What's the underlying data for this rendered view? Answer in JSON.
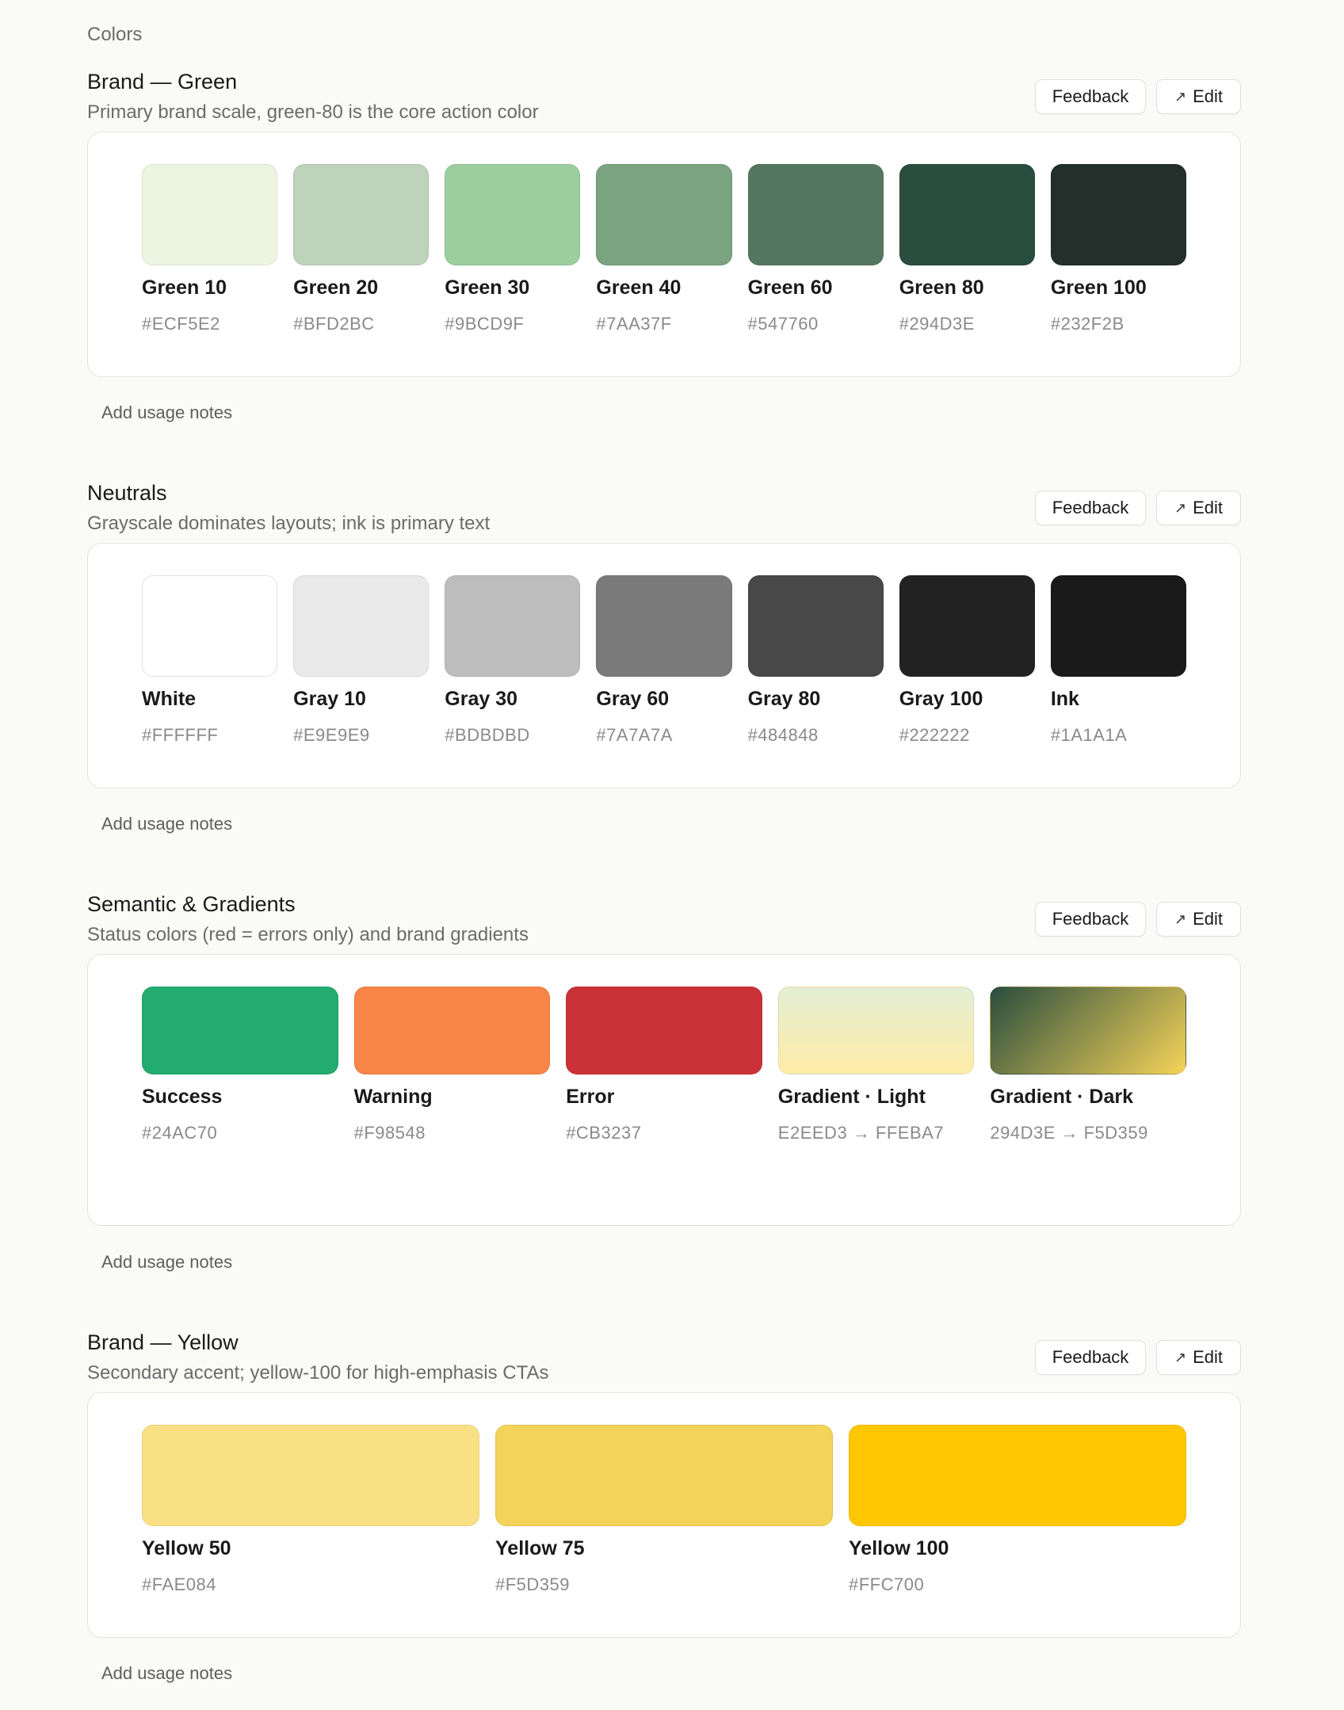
{
  "page_label": "Colors",
  "buttons": {
    "feedback_label": "Feedback",
    "edit_label": "Edit",
    "edit_icon": "↗",
    "usage_notes_label": "Add usage notes"
  },
  "sections": [
    {
      "title": "Brand — Green",
      "subtitle": "Primary brand scale, green-80 is the core action color",
      "swatches": [
        {
          "name": "Green 10",
          "hex": "#ECF5E2",
          "color": "#ECF5E2"
        },
        {
          "name": "Green 20",
          "hex": "#BFD2BC",
          "color": "#BFD2BC"
        },
        {
          "name": "Green 30",
          "hex": "#9BCD9F",
          "color": "#9BCD9F"
        },
        {
          "name": "Green 40",
          "hex": "#7AA37F",
          "color": "#7AA37F"
        },
        {
          "name": "Green 60",
          "hex": "#547760",
          "color": "#547760"
        },
        {
          "name": "Green 80",
          "hex": "#294D3E",
          "color": "#294D3E"
        },
        {
          "name": "Green 100",
          "hex": "#232F2B",
          "color": "#232F2B"
        }
      ]
    },
    {
      "title": "Neutrals",
      "subtitle": "Grayscale dominates layouts; ink is primary text",
      "swatches": [
        {
          "name": "White",
          "hex": "#FFFFFF",
          "color": "#FFFFFF"
        },
        {
          "name": "Gray 10",
          "hex": "#E9E9E9",
          "color": "#E9E9E9"
        },
        {
          "name": "Gray 30",
          "hex": "#BDBDBD",
          "color": "#BDBDBD"
        },
        {
          "name": "Gray 60",
          "hex": "#7A7A7A",
          "color": "#7A7A7A"
        },
        {
          "name": "Gray 80",
          "hex": "#484848",
          "color": "#484848"
        },
        {
          "name": "Gray 100",
          "hex": "#222222",
          "color": "#222222"
        },
        {
          "name": "Ink",
          "hex": "#1A1A1A",
          "color": "#1A1A1A"
        }
      ]
    },
    {
      "title": "Semantic & Gradients",
      "subtitle": "Status colors (red = errors only) and brand gradients",
      "swatches": [
        {
          "name": "Success",
          "hex": "#24AC70",
          "color": "#24AC70"
        },
        {
          "name": "Warning",
          "hex": "#F98548",
          "color": "#F98548"
        },
        {
          "name": "Error",
          "hex": "#CB3237",
          "color": "#CB3237"
        },
        {
          "name": "Gradient · Light",
          "hex": "E2EED3 → FFEBA7",
          "gradient": [
            "#E2EED3",
            "#FFEBA7"
          ],
          "gradient_direction": "to bottom"
        },
        {
          "name": "Gradient · Dark",
          "hex": "294D3E → F5D359",
          "gradient": [
            "#294D3E",
            "#F5D359"
          ],
          "gradient_direction": "135deg"
        }
      ]
    },
    {
      "title": "Brand — Yellow",
      "subtitle": "Secondary accent; yellow-100 for high-emphasis CTAs",
      "swatches": [
        {
          "name": "Yellow 50",
          "hex": "#FAE084",
          "color": "#FAE084"
        },
        {
          "name": "Yellow 75",
          "hex": "#F5D359",
          "color": "#F5D359"
        },
        {
          "name": "Yellow 100",
          "hex": "#FFC700",
          "color": "#FFC700"
        }
      ]
    }
  ]
}
